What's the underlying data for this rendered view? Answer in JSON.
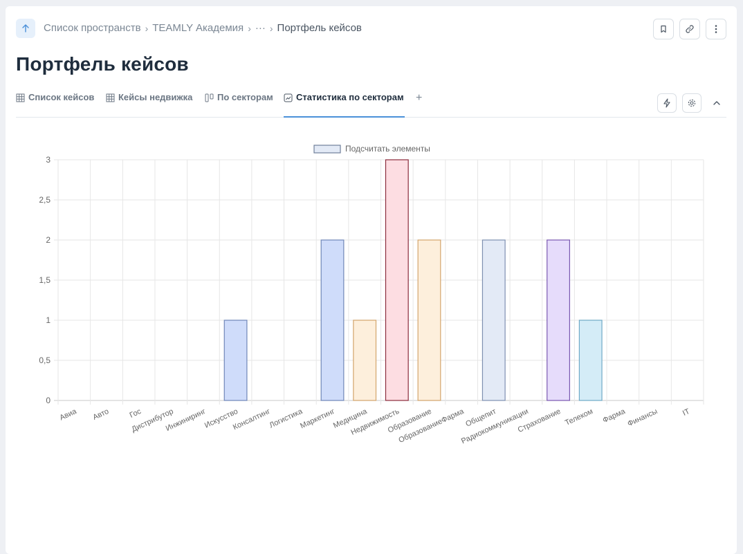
{
  "breadcrumb": {
    "items": [
      "Список пространств",
      "TEAMLY Академия",
      "···"
    ],
    "current": "Портфель кейсов"
  },
  "page": {
    "title": "Портфель кейсов"
  },
  "tabs": [
    {
      "label": "Список кейсов",
      "icon": "table-icon"
    },
    {
      "label": "Кейсы недвижка",
      "icon": "table-icon"
    },
    {
      "label": "По секторам",
      "icon": "kanban-icon"
    },
    {
      "label": "Статистика по секторам",
      "icon": "chart-icon",
      "active": true
    }
  ],
  "tab_add": "+",
  "chart_data": {
    "type": "bar",
    "legend": "Подсчитать элементы",
    "legend_position": "top",
    "categories": [
      "Авиа",
      "Авто",
      "Гос",
      "Дистрибутор",
      "Инжиниринг",
      "Искусство",
      "Консалтинг",
      "Логистика",
      "Маркетинг",
      "Медицина",
      "Недвижимость",
      "Образование",
      "ОбразованиеФарма",
      "Общепит",
      "Радиокоммуникации",
      "Страхование",
      "Телеком",
      "Фарма",
      "Финансы",
      "IT"
    ],
    "values": [
      0,
      0,
      0,
      0,
      0,
      1,
      0,
      0,
      2,
      1,
      3,
      2,
      0,
      2,
      0,
      2,
      1,
      0,
      0,
      0
    ],
    "ylim": [
      0,
      3
    ],
    "yticks": [
      "0",
      "0,5",
      "1",
      "1,5",
      "2",
      "2,5",
      "3"
    ],
    "grid": true,
    "colors": {
      "Искусство": {
        "fill": "#cfdcfa",
        "stroke": "#6f86b8"
      },
      "Маркетинг": {
        "fill": "#cfdcfa",
        "stroke": "#6f86b8"
      },
      "Медицина": {
        "fill": "#fdefdc",
        "stroke": "#d3a46b"
      },
      "Недвижимость": {
        "fill": "#fddde2",
        "stroke": "#8b2b3c"
      },
      "Образование": {
        "fill": "#fdefdc",
        "stroke": "#d3a46b"
      },
      "Общепит": {
        "fill": "#e3eaf6",
        "stroke": "#7d8fb0"
      },
      "Страхование": {
        "fill": "#e6dcfb",
        "stroke": "#7a58b0"
      },
      "Телеком": {
        "fill": "#d4ecf7",
        "stroke": "#6fa9c6"
      },
      "legend": {
        "fill": "#e3eaf6",
        "stroke": "#6f7e9a"
      }
    }
  }
}
